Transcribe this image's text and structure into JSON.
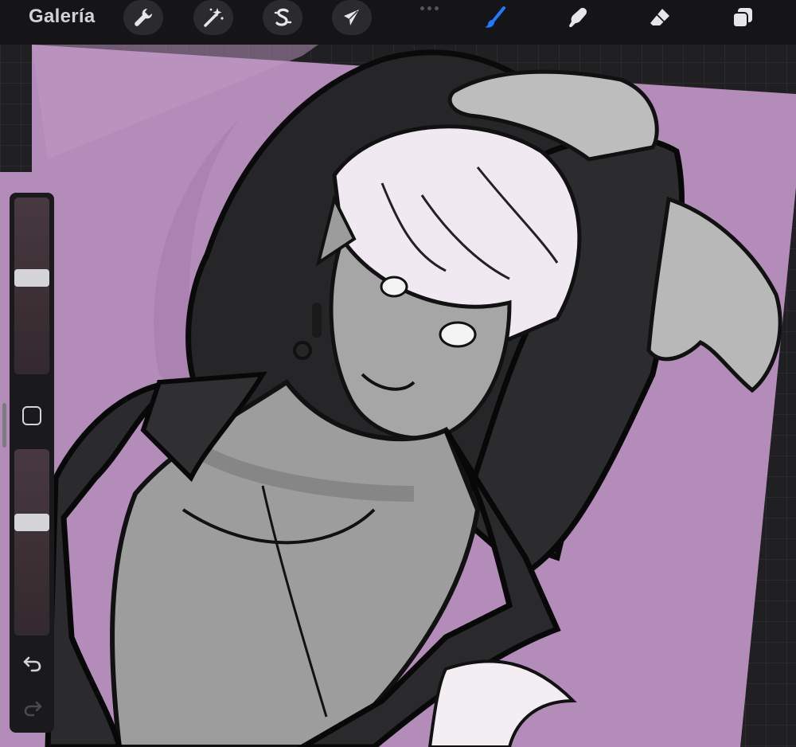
{
  "topbar": {
    "gallery_label": "Galería",
    "tools_left": [
      {
        "name": "actions",
        "icon": "wrench-icon"
      },
      {
        "name": "adjustments",
        "icon": "magic-wand-icon"
      },
      {
        "name": "selection",
        "icon": "selection-s-icon"
      },
      {
        "name": "transform",
        "icon": "arrow-cursor-icon"
      }
    ],
    "tools_right": [
      {
        "name": "brush",
        "icon": "brush-icon",
        "active": true
      },
      {
        "name": "smudge",
        "icon": "smudge-finger-icon"
      },
      {
        "name": "eraser",
        "icon": "eraser-icon"
      },
      {
        "name": "layers",
        "icon": "layers-icon"
      }
    ]
  },
  "sidebar": {
    "brush_size_level": 0.55,
    "opacity_level": 0.62,
    "modify_icon": "square-icon",
    "undo_icon": "undo-arrow-icon",
    "redo_icon": "redo-arrow-icon"
  },
  "colors": {
    "canvas_background": "#b48cba",
    "active_tool": "#1e7bff",
    "toolbar": "#151517"
  }
}
